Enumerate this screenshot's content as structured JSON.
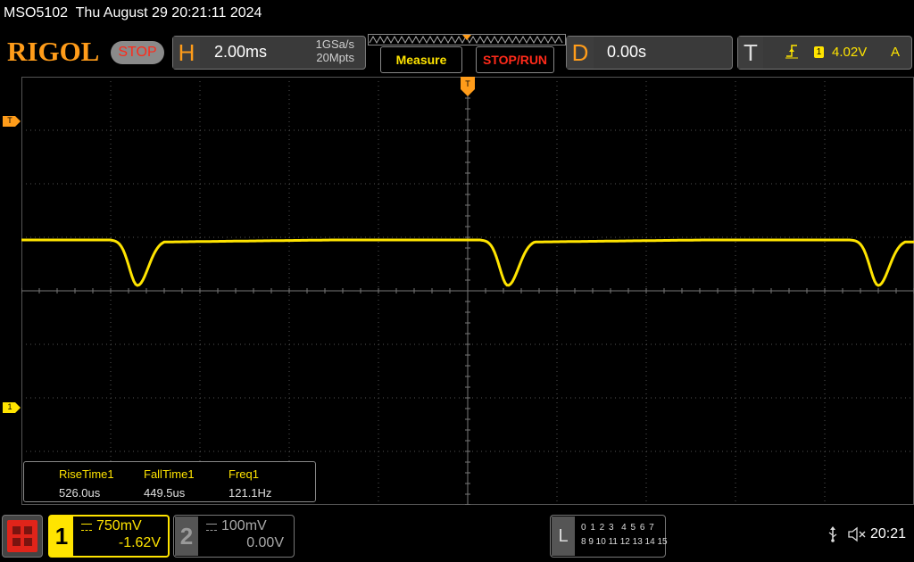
{
  "title_bar": {
    "model": "MSO5102",
    "datetime": "Thu August 29 20:21:11 2024"
  },
  "top_bar": {
    "logo": "RIGOL",
    "run_state": "STOP",
    "horizontal": {
      "letter": "H",
      "timebase": "2.00ms",
      "sample_rate": "1GSa/s",
      "memory_depth": "20Mpts"
    },
    "measure_button": "Measure",
    "stop_run_button": "STOP/RUN",
    "delay": {
      "letter": "D",
      "value": "0.00s"
    },
    "trigger": {
      "letter": "T",
      "source": "1",
      "level": "4.02V",
      "mode": "A"
    }
  },
  "screen": {
    "grid_divisions": {
      "horizontal": 10,
      "vertical": 8
    },
    "trace_color": "#ffe400",
    "markers": {
      "trigger_level_marker": "T",
      "channel1_marker": "1",
      "trigger_position_marker": "T"
    },
    "waveform": {
      "description_level": "baseline ~0.7 div above center, dips to center",
      "dip_positions_div": [
        1.3,
        5.45,
        9.6
      ]
    }
  },
  "measurements": [
    {
      "label": "RiseTime1",
      "value": "526.0us"
    },
    {
      "label": "FallTime1",
      "value": "449.5us"
    },
    {
      "label": "Freq1",
      "value": "121.1Hz"
    }
  ],
  "bottom_bar": {
    "channel1": {
      "number": "1",
      "scale": "750mV",
      "offset": "-1.62V",
      "color": "#ffe400"
    },
    "channel2": {
      "number": "2",
      "scale": "100mV",
      "offset": "0.00V"
    },
    "logic": {
      "letter": "L",
      "row1": "0 1 2 3  4 5 6 7",
      "row2": "8 9 10 11 12 13 14 15"
    },
    "clock": "20:21"
  }
}
